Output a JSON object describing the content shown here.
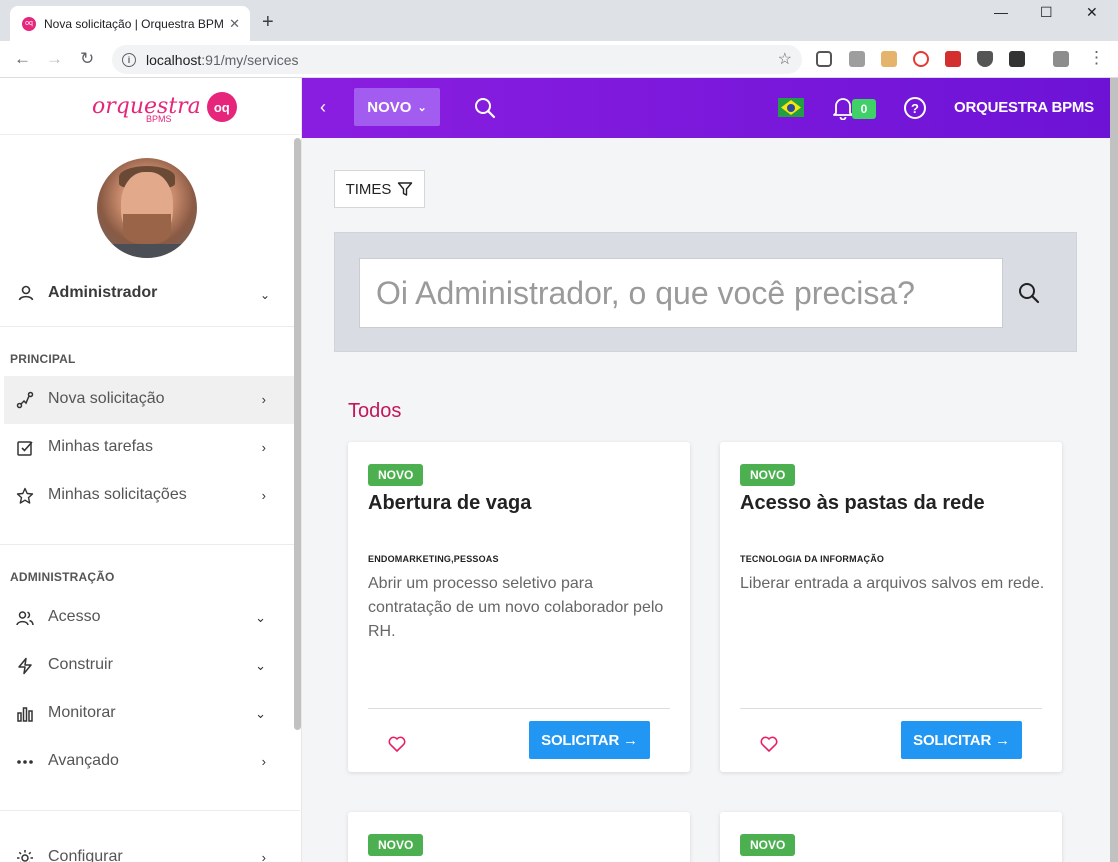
{
  "browser": {
    "tab_title": "Nova solicitação | Orquestra BPMS",
    "tab_close": "✕",
    "new_tab": "+",
    "url_host": "localhost",
    "url_port_path": ":91/my/services",
    "win_min": "—",
    "win_max": "☐",
    "win_close": "✕"
  },
  "sidebar": {
    "logo_word": "orquestra",
    "logo_sub": "BPMS",
    "logo_mark": "oq",
    "user_name": "Administrador",
    "sections": {
      "principal": "PRINCIPAL",
      "administracao": "ADMINISTRAÇÃO"
    },
    "principal_items": [
      {
        "label": "Nova solicitação",
        "icon": "route-icon"
      },
      {
        "label": "Minhas tarefas",
        "icon": "checkbox-icon"
      },
      {
        "label": "Minhas solicitações",
        "icon": "star-icon"
      }
    ],
    "admin_items": [
      {
        "label": "Acesso",
        "icon": "users-icon"
      },
      {
        "label": "Construir",
        "icon": "bolt-icon"
      },
      {
        "label": "Monitorar",
        "icon": "bar-chart-icon"
      },
      {
        "label": "Avançado",
        "icon": "more-icon"
      },
      {
        "label": "Configurar",
        "icon": "gear-icon"
      }
    ]
  },
  "appbar": {
    "novo_label": "NOVO",
    "notifications_count": "0",
    "help": "?",
    "brand": "ORQUESTRA BPMS"
  },
  "main": {
    "times_label": "TIMES",
    "search_placeholder": "Oi Administrador, o que você precisa?",
    "section_title": "Todos",
    "cards": [
      {
        "tag": "NOVO",
        "title": "Abertura de vaga",
        "category": "ENDOMARKETING,PESSOAS",
        "description": "Abrir um processo seletivo para contratação de um novo colaborador pelo RH.",
        "button": "SOLICITAR →"
      },
      {
        "tag": "NOVO",
        "title": "Acesso às pastas da rede",
        "category": "TECNOLOGIA DA INFORMAÇÃO",
        "description": "Liberar entrada a arquivos salvos em rede.",
        "button": "SOLICITAR →"
      },
      {
        "tag": "NOVO"
      },
      {
        "tag": "NOVO"
      }
    ]
  },
  "colors": {
    "appbar_start": "#8a1ee0",
    "appbar_end": "#6d13d6",
    "brand_pink": "#e5267b",
    "tag_green": "#4caf50",
    "button_blue": "#2196f3",
    "section_title": "#c2185b"
  }
}
